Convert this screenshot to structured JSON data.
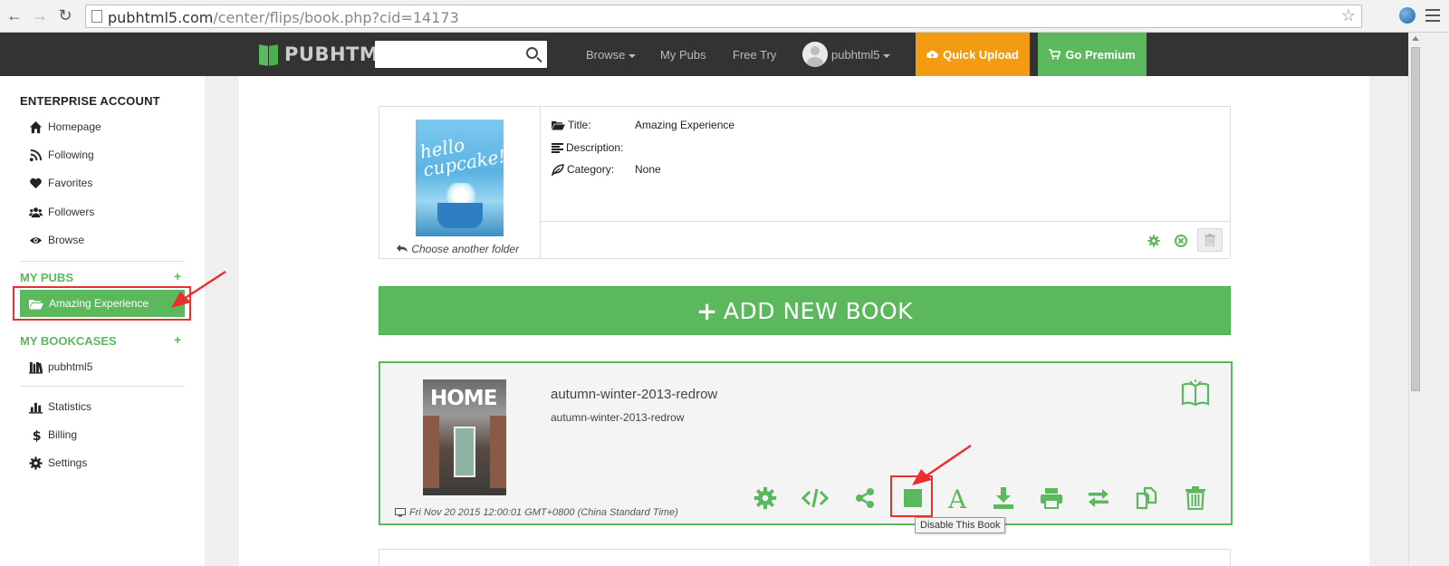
{
  "browser": {
    "url_host": "pubhtml5.com",
    "url_path": "/center/flips/book.php?cid=14173"
  },
  "header": {
    "logo_text": "PUBHTML5",
    "search_placeholder": "",
    "nav_browse": "Browse",
    "nav_mypubs": "My Pubs",
    "nav_freetry": "Free Try",
    "username": "pubhtml5",
    "quick_upload": "Quick Upload",
    "go_premium": "Go Premium"
  },
  "sidebar": {
    "account_title": "ENTERPRISE ACCOUNT",
    "items": [
      {
        "label": "Homepage",
        "icon": "home-icon"
      },
      {
        "label": "Following",
        "icon": "rss-icon"
      },
      {
        "label": "Favorites",
        "icon": "heart-icon"
      },
      {
        "label": "Followers",
        "icon": "users-icon"
      },
      {
        "label": "Browse",
        "icon": "eye-icon"
      }
    ],
    "my_pubs": "MY PUBS",
    "active_folder": "Amazing Experience",
    "my_bookcases": "MY BOOKCASES",
    "bookcase": "pubhtml5",
    "bottom_items": [
      {
        "label": "Statistics",
        "icon": "bar-chart-icon"
      },
      {
        "label": "Billing",
        "icon": "dollar-icon"
      },
      {
        "label": "Settings",
        "icon": "gear-icon"
      }
    ]
  },
  "folder": {
    "title_label": "Title:",
    "title_value": "Amazing Experience",
    "description_label": "Description:",
    "description_value": "",
    "category_label": "Category:",
    "category_value": "None",
    "choose_folder": "Choose another folder"
  },
  "add_book_label": "ADD NEW BOOK",
  "book": {
    "title": "autumn-winter-2013-redrow",
    "subtitle": "autumn-winter-2013-redrow",
    "date": "Fri Nov 20 2015 12:00:01 GMT+0800 (China Standard Time)",
    "tooltip": "Disable This Book"
  },
  "colors": {
    "green": "#5cb85c",
    "orange": "#f39c12",
    "header": "#333333",
    "annotation_red": "#e8312f"
  }
}
